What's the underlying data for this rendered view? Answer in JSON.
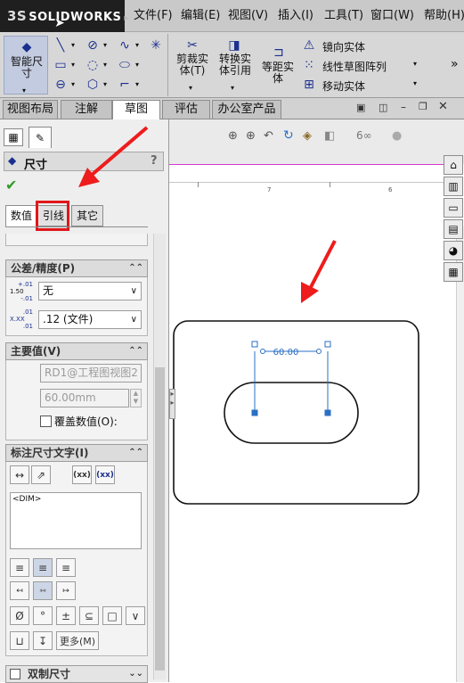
{
  "app": {
    "logo_prefix": "3S",
    "logo_name": "SOLIDWORKS",
    "logo_caret": "▸"
  },
  "menu": [
    "文件(F)",
    "编辑(E)",
    "视图(V)",
    "插入(I)",
    "工具(T)",
    "窗口(W)",
    "帮助(H)"
  ],
  "ribbon": {
    "smart_dim_label": "智能尺寸",
    "trim_label": "剪裁实体(T)",
    "convert_label": "转换实体引用",
    "offset_label": "等距实体",
    "mirror_label": "镜向实体",
    "linear_pattern_label": "线性草图阵列",
    "move_label": "移动实体",
    "more": "»"
  },
  "tabs": [
    "视图布局",
    "注解",
    "草图",
    "评估",
    "办公室产品"
  ],
  "active_tab": "草图",
  "property_manager": {
    "title": "尺寸",
    "help": "?",
    "ok": "✔",
    "subtabs": [
      "数值",
      "引线",
      "其它"
    ],
    "tolerance": {
      "title": "公差/精度(P)",
      "tol_type": "无",
      "precision": ".12 (文件)",
      "tol_icon_top": "+.01",
      "tol_icon_mid": "1.50",
      "tol_icon_bot": "-.01",
      "prec_icon_top": ".01",
      "prec_icon_mid": "X.XX",
      "prec_icon_bot": ".01"
    },
    "primary": {
      "title": "主要值(V)",
      "ref": "RD1@工程图视图2",
      "value": "60.00mm",
      "override_label": "覆盖数值(O):"
    },
    "dim_text": {
      "title": "标注尺寸文字(I)",
      "text": "<DIM>",
      "btn_paren1": "(xx)",
      "btn_paren2": "(xx)",
      "more_btn": "更多(M)",
      "symbols": [
        "Ø",
        "°",
        "±",
        "⊆",
        "□",
        "∨"
      ]
    },
    "dual": {
      "title": "双制尺寸"
    }
  },
  "drawing": {
    "dimension": "60.00",
    "ruler_marks": [
      "7",
      "6"
    ]
  },
  "icons": {
    "view_toolbar": [
      "zoom-fit-icon",
      "zoom-area-icon",
      "previous-view-icon",
      "rotate-icon",
      "display-style-icon",
      "hide-show-icon",
      "view-settings-icon",
      "appearance-icon"
    ],
    "task_pane": [
      "home-icon",
      "design-library-icon",
      "file-explorer-icon",
      "view-palette-icon",
      "appearances-icon",
      "custom-properties-icon"
    ]
  },
  "colors": {
    "accent": "#1b2f8e",
    "arrow": "#ee1c1c",
    "highlight_box": "#e0161a",
    "drawing_line": "#111111",
    "dim_color": "#2a6fc4"
  }
}
